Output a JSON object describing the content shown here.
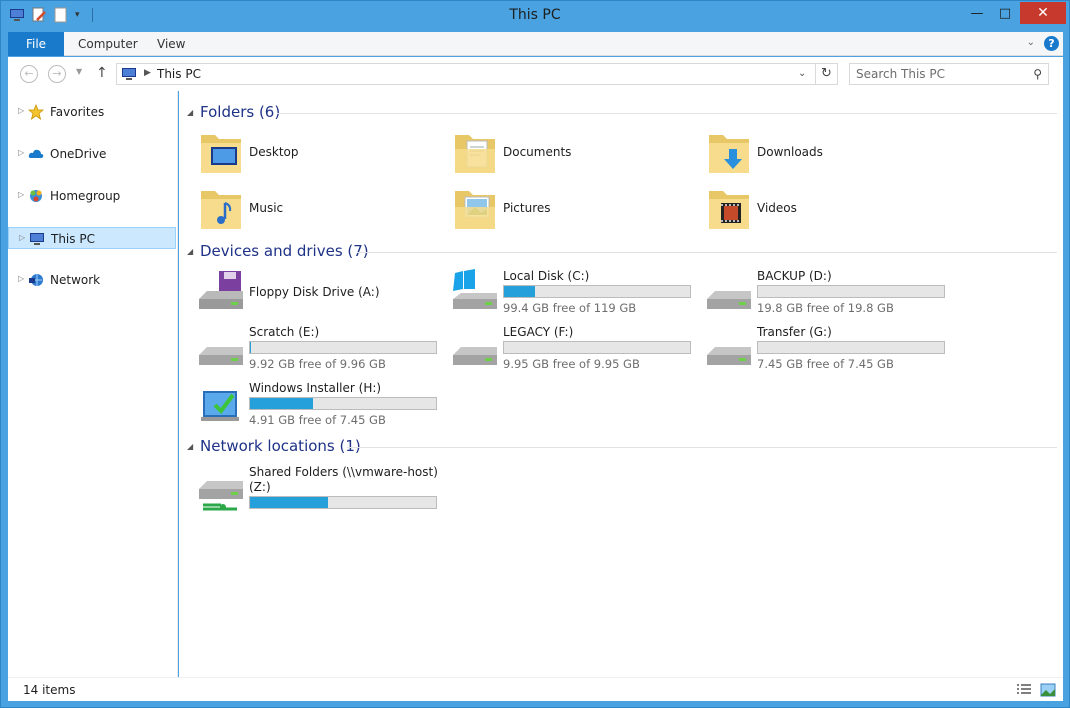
{
  "window": {
    "title": "This PC"
  },
  "ribbon": {
    "tabs": [
      "File",
      "Computer",
      "View"
    ],
    "help_label": "?"
  },
  "navbar": {
    "address": "This PC",
    "search_placeholder": "Search This PC"
  },
  "nav_pane": {
    "items": [
      {
        "label": "Favorites",
        "icon": "star-icon"
      },
      {
        "label": "OneDrive",
        "icon": "onedrive-cloud-icon"
      },
      {
        "label": "Homegroup",
        "icon": "homegroup-icon"
      },
      {
        "label": "This PC",
        "icon": "computer-icon",
        "selected": true
      },
      {
        "label": "Network",
        "icon": "network-icon"
      }
    ]
  },
  "groups": {
    "folders": {
      "title": "Folders (6)",
      "items": [
        {
          "name": "Desktop",
          "icon": "desktop-folder-icon"
        },
        {
          "name": "Documents",
          "icon": "documents-folder-icon"
        },
        {
          "name": "Downloads",
          "icon": "downloads-folder-icon"
        },
        {
          "name": "Music",
          "icon": "music-folder-icon"
        },
        {
          "name": "Pictures",
          "icon": "pictures-folder-icon"
        },
        {
          "name": "Videos",
          "icon": "videos-folder-icon"
        }
      ]
    },
    "devices": {
      "title": "Devices and drives (7)",
      "items": [
        {
          "name": "Floppy Disk Drive (A:)",
          "icon": "floppy-drive-icon"
        },
        {
          "name": "Local Disk (C:)",
          "free": "99.4 GB free of 119 GB",
          "used_fraction": 0.165,
          "icon": "system-drive-icon"
        },
        {
          "name": "BACKUP (D:)",
          "free": "19.8 GB free of 19.8 GB",
          "used_fraction": 0.0,
          "icon": "hard-drive-icon"
        },
        {
          "name": "Scratch (E:)",
          "free": "9.92 GB free of 9.96 GB",
          "used_fraction": 0.004,
          "icon": "hard-drive-icon"
        },
        {
          "name": "LEGACY (F:)",
          "free": "9.95 GB free of 9.95 GB",
          "used_fraction": 0.0,
          "icon": "hard-drive-icon"
        },
        {
          "name": "Transfer (G:)",
          "free": "7.45 GB free of 7.45 GB",
          "used_fraction": 0.0,
          "icon": "hard-drive-icon"
        },
        {
          "name": "Windows Installer (H:)",
          "free": "4.91 GB free of 7.45 GB",
          "used_fraction": 0.34,
          "icon": "installer-drive-icon"
        }
      ]
    },
    "network": {
      "title": "Network locations (1)",
      "items": [
        {
          "name": "Shared Folders (\\\\vmware-host)",
          "name2": "(Z:)",
          "used_fraction": 0.42,
          "icon": "network-drive-icon"
        }
      ]
    }
  },
  "status": {
    "count": "14 items"
  },
  "colors": {
    "accent": "#1979ca",
    "bar_fill": "#26a0da",
    "selection": "#cce8ff",
    "group_title": "#1e3287"
  }
}
